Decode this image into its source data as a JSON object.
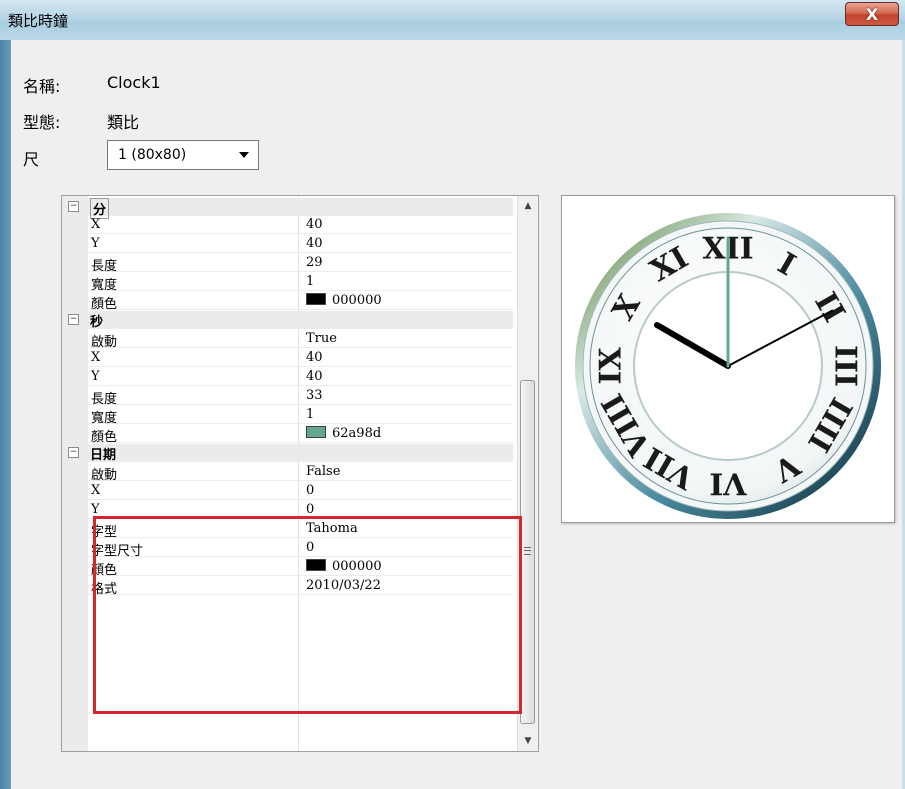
{
  "window": {
    "title": "類比時鐘",
    "close_label": "X"
  },
  "info": {
    "name_label": "名稱:",
    "name_value": "Clock1",
    "type_label": "型態:",
    "type_value": "類比",
    "size_label": "尺",
    "size_value": "1  (80x80)"
  },
  "grid": {
    "cat_minute": {
      "label": "分",
      "toggle": "−"
    },
    "minute": {
      "x": {
        "name": "X",
        "value": "40"
      },
      "y": {
        "name": "Y",
        "value": "40"
      },
      "length": {
        "name": "長度",
        "value": "29"
      },
      "width": {
        "name": "寬度",
        "value": "1"
      },
      "color": {
        "name": "顏色",
        "value": "000000",
        "swatch": "#000000"
      }
    },
    "cat_second": {
      "label": "秒",
      "toggle": "−"
    },
    "second": {
      "enable": {
        "name": "啟動",
        "value": "True"
      },
      "x": {
        "name": "X",
        "value": "40"
      },
      "y": {
        "name": "Y",
        "value": "40"
      },
      "length": {
        "name": "長度",
        "value": "33"
      },
      "width": {
        "name": "寬度",
        "value": "1"
      },
      "color": {
        "name": "顏色",
        "value": "62a98d",
        "swatch": "#62a98d"
      }
    },
    "cat_date": {
      "label": "日期",
      "toggle": "−"
    },
    "date": {
      "enable": {
        "name": "啟動",
        "value": "False"
      },
      "x": {
        "name": "X",
        "value": "0"
      },
      "y": {
        "name": "Y",
        "value": "0"
      },
      "font": {
        "name": "字型",
        "value": "Tahoma"
      },
      "font_size": {
        "name": "字型尺寸",
        "value": "0"
      },
      "color": {
        "name": "顏色",
        "value": "000000",
        "swatch": "#000000"
      },
      "format": {
        "name": "格式",
        "value": "2010/03/22"
      }
    }
  },
  "clock": {
    "numerals": [
      "XII",
      "I",
      "II",
      "III",
      "IIII",
      "V",
      "VI",
      "VII",
      "VIII",
      "IX",
      "X",
      "XI"
    ],
    "hour_hand_color": "#000000",
    "minute_hand_color": "#000000",
    "second_hand_color": "#62a98d"
  },
  "colors": {
    "highlight": "#d42530"
  }
}
